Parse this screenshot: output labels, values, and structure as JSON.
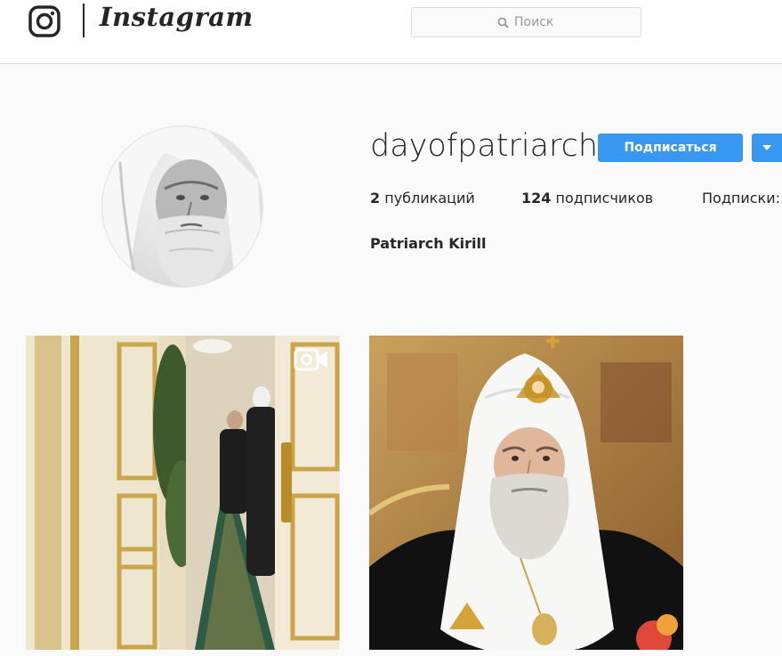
{
  "header": {
    "logo_text": "Instagram",
    "search_placeholder": "Поиск"
  },
  "profile": {
    "username": "dayofpatriarch",
    "follow_label": "Подписаться",
    "stats": {
      "posts_count": "2",
      "posts_label": "публикаций",
      "followers_count": "124",
      "followers_label": "подписчиков",
      "following_label": "Подписки:"
    },
    "full_name": "Patriarch Kirill"
  },
  "posts": [
    {
      "type": "video"
    },
    {
      "type": "photo"
    }
  ],
  "colors": {
    "accent": "#3897f0",
    "text": "#262626",
    "background": "#fafafa",
    "border": "#dbdbdb"
  }
}
